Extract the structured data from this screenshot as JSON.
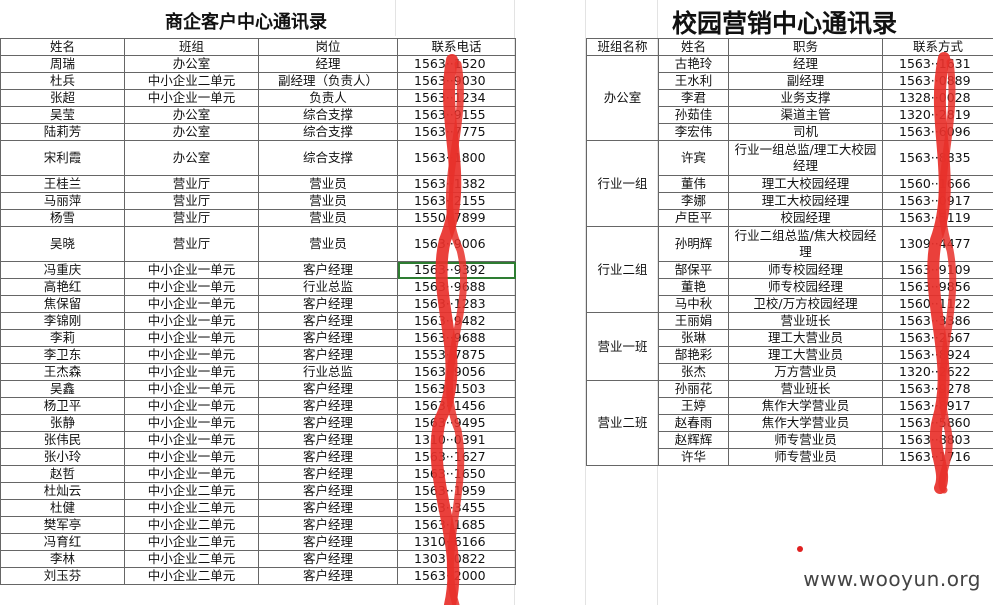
{
  "left_title": "商企客户中心通讯录",
  "right_title": "校园营销中心通讯录",
  "left_headers": [
    "姓名",
    "班组",
    "岗位",
    "联系电话"
  ],
  "left_rows": [
    [
      "周瑞",
      "办公室",
      "经理",
      "1563··1520"
    ],
    [
      "杜兵",
      "中小企业二单元",
      "副经理（负责人）",
      "1563··9030"
    ],
    [
      "张超",
      "中小企业一单元",
      "负责人",
      "1563··1234"
    ],
    [
      "吴莹",
      "办公室",
      "综合支撑",
      "1563··9155"
    ],
    [
      "陆莉芳",
      "办公室",
      "综合支撑",
      "1563··7775"
    ],
    [
      "宋利霞",
      "办公室",
      "综合支撑",
      "1563··1800"
    ],
    [
      "王桂兰",
      "营业厅",
      "营业员",
      "1563··1382"
    ],
    [
      "马丽萍",
      "营业厅",
      "营业员",
      "1563··2155"
    ],
    [
      "杨雪",
      "营业厅",
      "营业员",
      "1550··7899"
    ],
    [
      "吴晓",
      "营业厅",
      "营业员",
      "1563··9006"
    ],
    [
      "冯重庆",
      "中小企业一单元",
      "客户经理",
      "1563··9392"
    ],
    [
      "高艳红",
      "中小企业一单元",
      "行业总监",
      "1563··9688"
    ],
    [
      "焦保留",
      "中小企业一单元",
      "客户经理",
      "1563··1283"
    ],
    [
      "李锦刚",
      "中小企业一单元",
      "客户经理",
      "1563··9482"
    ],
    [
      "李莉",
      "中小企业一单元",
      "客户经理",
      "1563··9688"
    ],
    [
      "李卫东",
      "中小企业一单元",
      "客户经理",
      "1553··7875"
    ],
    [
      "王杰森",
      "中小企业一单元",
      "行业总监",
      "1563··9056"
    ],
    [
      "吴鑫",
      "中小企业一单元",
      "客户经理",
      "1563··1503"
    ],
    [
      "杨卫平",
      "中小企业一单元",
      "客户经理",
      "1563··1456"
    ],
    [
      "张静",
      "中小企业一单元",
      "客户经理",
      "1563··9495"
    ],
    [
      "张伟民",
      "中小企业一单元",
      "客户经理",
      "1310··0391"
    ],
    [
      "张小玲",
      "中小企业一单元",
      "客户经理",
      "1563··1627"
    ],
    [
      "赵哲",
      "中小企业一单元",
      "客户经理",
      "1563··1650"
    ],
    [
      "杜灿云",
      "中小企业二单元",
      "客户经理",
      "1563··1959"
    ],
    [
      "杜健",
      "中小企业二单元",
      "客户经理",
      "1563··3455"
    ],
    [
      "樊军亭",
      "中小企业二单元",
      "客户经理",
      "1563··1685"
    ],
    [
      "冯育红",
      "中小企业二单元",
      "客户经理",
      "1310··6166"
    ],
    [
      "李林",
      "中小企业二单元",
      "客户经理",
      "1303··0822"
    ],
    [
      "刘玉芬",
      "中小企业二单元",
      "客户经理",
      "1563··2000"
    ]
  ],
  "right_headers": [
    "班组名称",
    "姓名",
    "职务",
    "联系方式"
  ],
  "right_groups": [
    {
      "group": "办公室",
      "rows": [
        [
          "古艳玲",
          "经理",
          "1563··1631"
        ],
        [
          "王水利",
          "副经理",
          "1563··0889"
        ],
        [
          "李君",
          "业务支撑",
          "1328··0028"
        ],
        [
          "孙茹佳",
          "渠道主管",
          "1320··2819"
        ],
        [
          "李宏伟",
          "司机",
          "1563··6096"
        ]
      ]
    },
    {
      "group": "行业一组",
      "rows": [
        [
          "许宾",
          "行业一组总监/理工大校园经理",
          "1563··8835"
        ],
        [
          "董伟",
          "理工大校园经理",
          "1560··1666"
        ],
        [
          "李娜",
          "理工大校园经理",
          "1563··0917"
        ],
        [
          "卢臣平",
          "校园经理",
          "1563··5119"
        ]
      ]
    },
    {
      "group": "行业二组",
      "rows": [
        [
          "孙明辉",
          "行业二组总监/焦大校园经理",
          "1309··4477"
        ],
        [
          "郜保平",
          "师专校园经理",
          "1563··9109"
        ],
        [
          "董艳",
          "师专校园经理",
          "1563··9856"
        ],
        [
          "马中秋",
          "卫校/万方校园经理",
          "1560··1122"
        ]
      ]
    },
    {
      "group": "营业一班",
      "rows": [
        [
          "王丽娟",
          "营业班长",
          "1563··3386"
        ],
        [
          "张琳",
          "理工大营业员",
          "1563··2567"
        ],
        [
          "郜艳彩",
          "理工大营业员",
          "1563··8924"
        ],
        [
          "张杰",
          "万方营业员",
          "1320··2622"
        ]
      ]
    },
    {
      "group": "营业二班",
      "rows": [
        [
          "孙丽花",
          "营业班长",
          "1563··9278"
        ],
        [
          "王婷",
          "焦作大学营业员",
          "1563··8917"
        ],
        [
          "赵春雨",
          "焦作大学营业员",
          "1563··5860"
        ],
        [
          "赵辉辉",
          "师专营业员",
          "1563··8803"
        ],
        [
          "许华",
          "师专营业员",
          "1563··1716"
        ]
      ]
    }
  ],
  "watermark": "www.wooyun.org",
  "colors": {
    "redaction": "#e8302a",
    "selection": "#2e7d32",
    "grid": "#e3e3e3"
  }
}
